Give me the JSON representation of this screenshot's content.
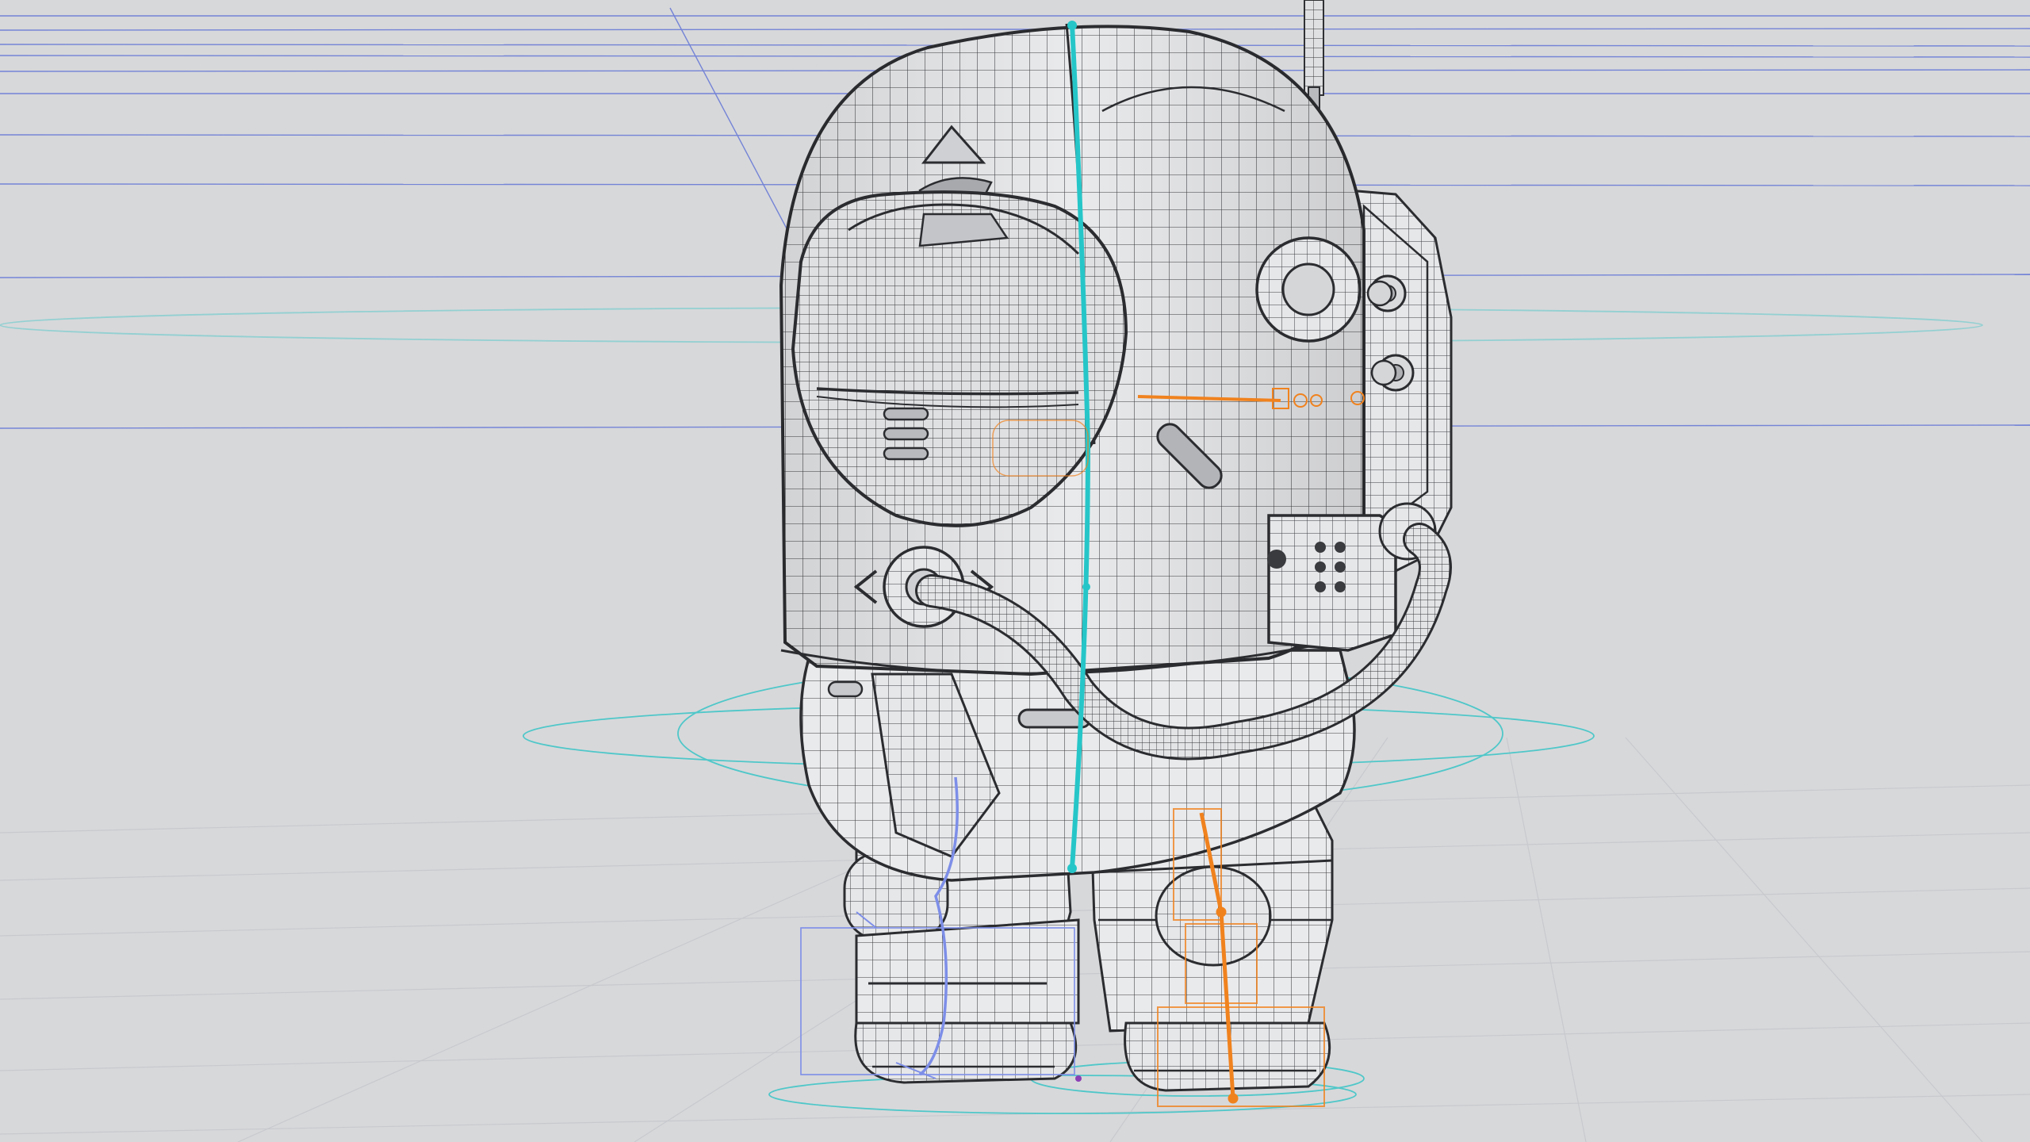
{
  "viewport": {
    "background": "#d7d8da",
    "mode": "wireframe-on-shaded",
    "camera": "perspective"
  },
  "model": {
    "name": "",
    "parts": [
      "helmet",
      "visor",
      "backpack",
      "torso",
      "belt",
      "hose",
      "left-leg",
      "right-leg",
      "antenna"
    ]
  },
  "rig": {
    "spine_color": "#26c6c8",
    "right_leg_color": "#f0821e",
    "left_leg_color": "#7d8ee8",
    "controller_color": "#4fc7c9"
  },
  "colors": {
    "mesh_fill": "#e9eaec",
    "mesh_wire": "#3a3b3e",
    "grid_line": "#5b6fd6",
    "floor_line": "#c5c7cb"
  }
}
